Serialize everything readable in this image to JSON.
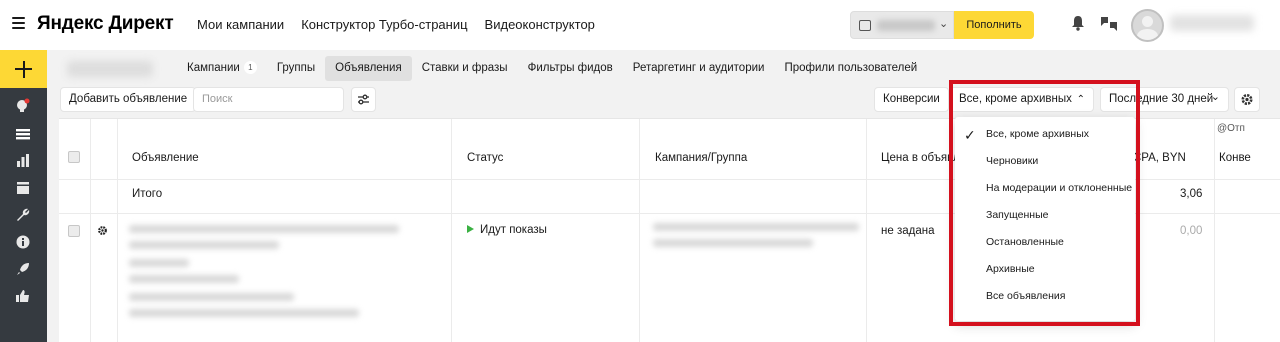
{
  "header": {
    "logo": "Яндекс Директ",
    "nav": [
      "Мои кампании",
      "Конструктор Турбо-страниц",
      "Видеоконструктор"
    ],
    "topup_label": "Пополнить"
  },
  "tabs": [
    {
      "label": "Кампании",
      "count": "1"
    },
    {
      "label": "Группы",
      "count": ""
    },
    {
      "label": "Объявления",
      "count": ""
    },
    {
      "label": "Ставки и фразы",
      "count": ""
    },
    {
      "label": "Фильтры фидов",
      "count": ""
    },
    {
      "label": "Ретаргетинг и аудитории",
      "count": ""
    },
    {
      "label": "Профили пользователей",
      "count": ""
    }
  ],
  "toolbar": {
    "add_ad": "Добавить объявление",
    "search_placeholder": "Поиск",
    "conversions": "Конверсии",
    "filter_selected": "Все, кроме архивных",
    "period": "Последние 30 дней"
  },
  "table": {
    "headers": {
      "ad": "Объявление",
      "status": "Статус",
      "campaign": "Кампания/Группа",
      "price": "Цена в объявл",
      "cpa": "CPA, BYN",
      "conv": "Конве",
      "top_right": "@Отп"
    },
    "total_label": "Итого",
    "total_cpa": "3,06",
    "row": {
      "status": "Идут показы",
      "price": "не задана",
      "cpa": "0,00"
    }
  },
  "dropdown": {
    "items": [
      "Все, кроме архивных",
      "Черновики",
      "На модерации и отклоненные",
      "Запущенные",
      "Остановленные",
      "Архивные",
      "Все объявления"
    ],
    "selected_index": 0
  },
  "colors": {
    "accent_yellow": "#fdd835",
    "sidebar": "#353a40",
    "highlight_red": "#d4101d",
    "status_green": "#3bb143"
  }
}
